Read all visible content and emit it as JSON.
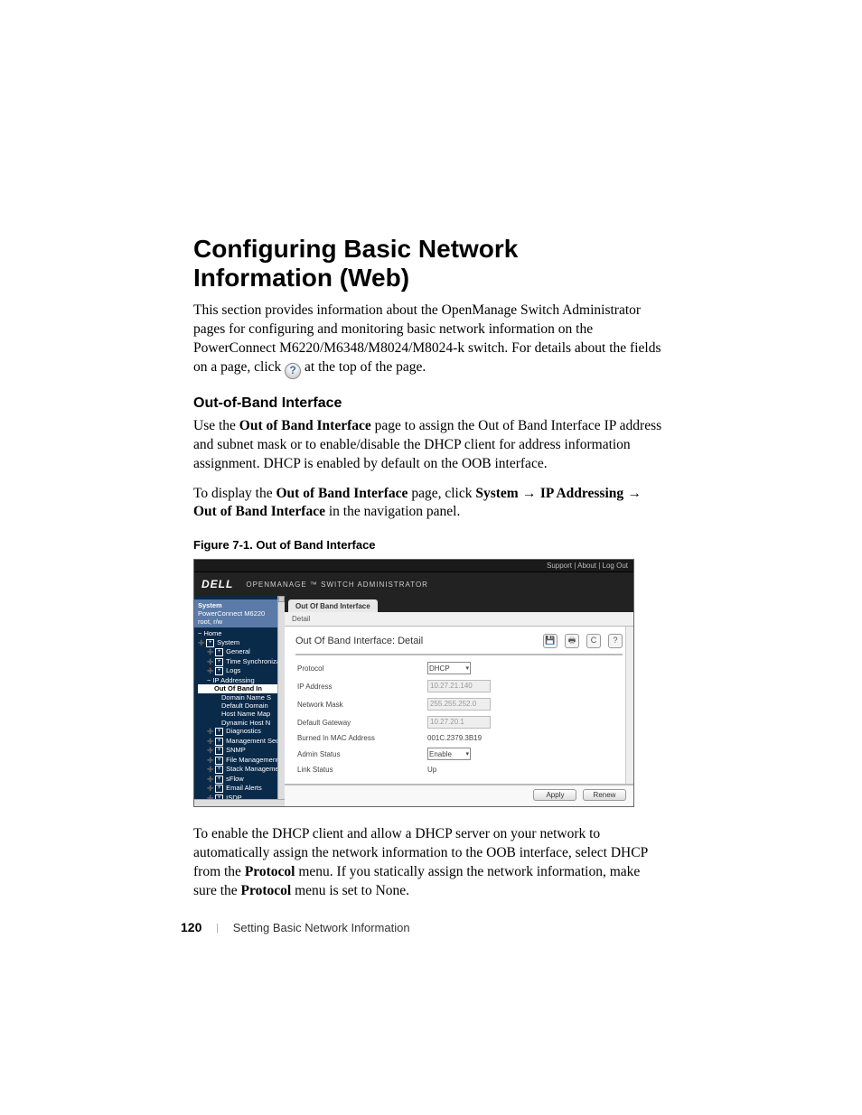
{
  "heading": "Configuring Basic Network Information (Web)",
  "intro_a": "This section provides information about the OpenManage Switch Administrator pages for configuring and monitoring basic network information on the PowerConnect M6220/M6348/M8024/M8024-k switch. For details about the fields on a page, click ",
  "intro_b": " at the top of the page.",
  "sub_heading": "Out-of-Band Interface",
  "p2_a": "Use the ",
  "p2_bold": "Out of Band Interface",
  "p2_b": " page to assign the Out of Band Interface IP address and subnet mask or to enable/disable the DHCP client for address information assignment. DHCP is enabled by default on the OOB interface.",
  "p3_a": "To display the ",
  "p3_bold1": "Out of Band Interface",
  "p3_b": " page, click ",
  "p3_bold2": "System",
  "p3_arrow": " → ",
  "p3_bold3": "IP Addressing",
  "p3_bold4": "Out of Band Interface",
  "p3_c": " in the navigation panel.",
  "fig_caption": "Figure 7-1.    Out of Band Interface",
  "p4_a": "To enable the DHCP client and allow a DHCP server on your network to automatically assign the network information to the OOB interface, select DHCP from the ",
  "p4_bold1": "Protocol",
  "p4_b": " menu. If you statically assign the network information, make sure the ",
  "p4_bold2": "Protocol",
  "p4_c": " menu is set to None.",
  "footer": {
    "page": "120",
    "title": "Setting Basic Network Information"
  },
  "shot": {
    "top_links": "Support  |  About  |  Log Out",
    "logo": "DELL",
    "brand": "OPENMANAGE ™  SWITCH  ADMINISTRATOR",
    "sys_block": {
      "l1": "System",
      "l2": "PowerConnect M6220",
      "l3": "root, r/w"
    },
    "nav": [
      {
        "cls": "lvl1",
        "t": "Home"
      },
      {
        "cls": "plus",
        "t": "System"
      },
      {
        "cls": "plus ind1",
        "t": "General"
      },
      {
        "cls": "plus ind1",
        "t": "Time Synchronization"
      },
      {
        "cls": "plus ind1",
        "t": "Logs"
      },
      {
        "cls": "lvl1 ind1",
        "t": "IP Addressing"
      },
      {
        "cls": "sel ind2",
        "t": "Out Of Band In"
      },
      {
        "cls": "ind3",
        "t": "Domain Name S"
      },
      {
        "cls": "ind3",
        "t": "Default Domain"
      },
      {
        "cls": "ind3",
        "t": "Host Name Map"
      },
      {
        "cls": "ind3",
        "t": "Dynamic Host N"
      },
      {
        "cls": "plus ind1",
        "t": "Diagnostics"
      },
      {
        "cls": "plus ind1",
        "t": "Management Security"
      },
      {
        "cls": "plus ind1",
        "t": "SNMP"
      },
      {
        "cls": "plus ind1",
        "t": "File Management"
      },
      {
        "cls": "plus ind1",
        "t": "Stack Management"
      },
      {
        "cls": "plus ind1",
        "t": "sFlow"
      },
      {
        "cls": "plus ind1",
        "t": "Email Alerts"
      },
      {
        "cls": "plus ind1",
        "t": "ISDP"
      }
    ],
    "tab": "Out Of Band Interface",
    "subtab": "Detail",
    "panel_title": "Out Of Band Interface: Detail",
    "icons": {
      "save": "💾",
      "print": "🖶",
      "refresh": "C",
      "help": "?"
    },
    "fields": [
      {
        "k": "Protocol",
        "type": "select",
        "v": "DHCP"
      },
      {
        "k": "IP Address",
        "type": "ro",
        "v": "10.27.21.140"
      },
      {
        "k": "Network Mask",
        "type": "ro",
        "v": "255.255.252.0"
      },
      {
        "k": "Default Gateway",
        "type": "ro",
        "v": "10.27.20.1"
      },
      {
        "k": "Burned In MAC Address",
        "type": "text",
        "v": "001C.2379.3B19"
      },
      {
        "k": "Admin Status",
        "type": "select",
        "v": "Enable"
      },
      {
        "k": "Link Status",
        "type": "text",
        "v": "Up"
      }
    ],
    "buttons": {
      "apply": "Apply",
      "renew": "Renew"
    }
  }
}
